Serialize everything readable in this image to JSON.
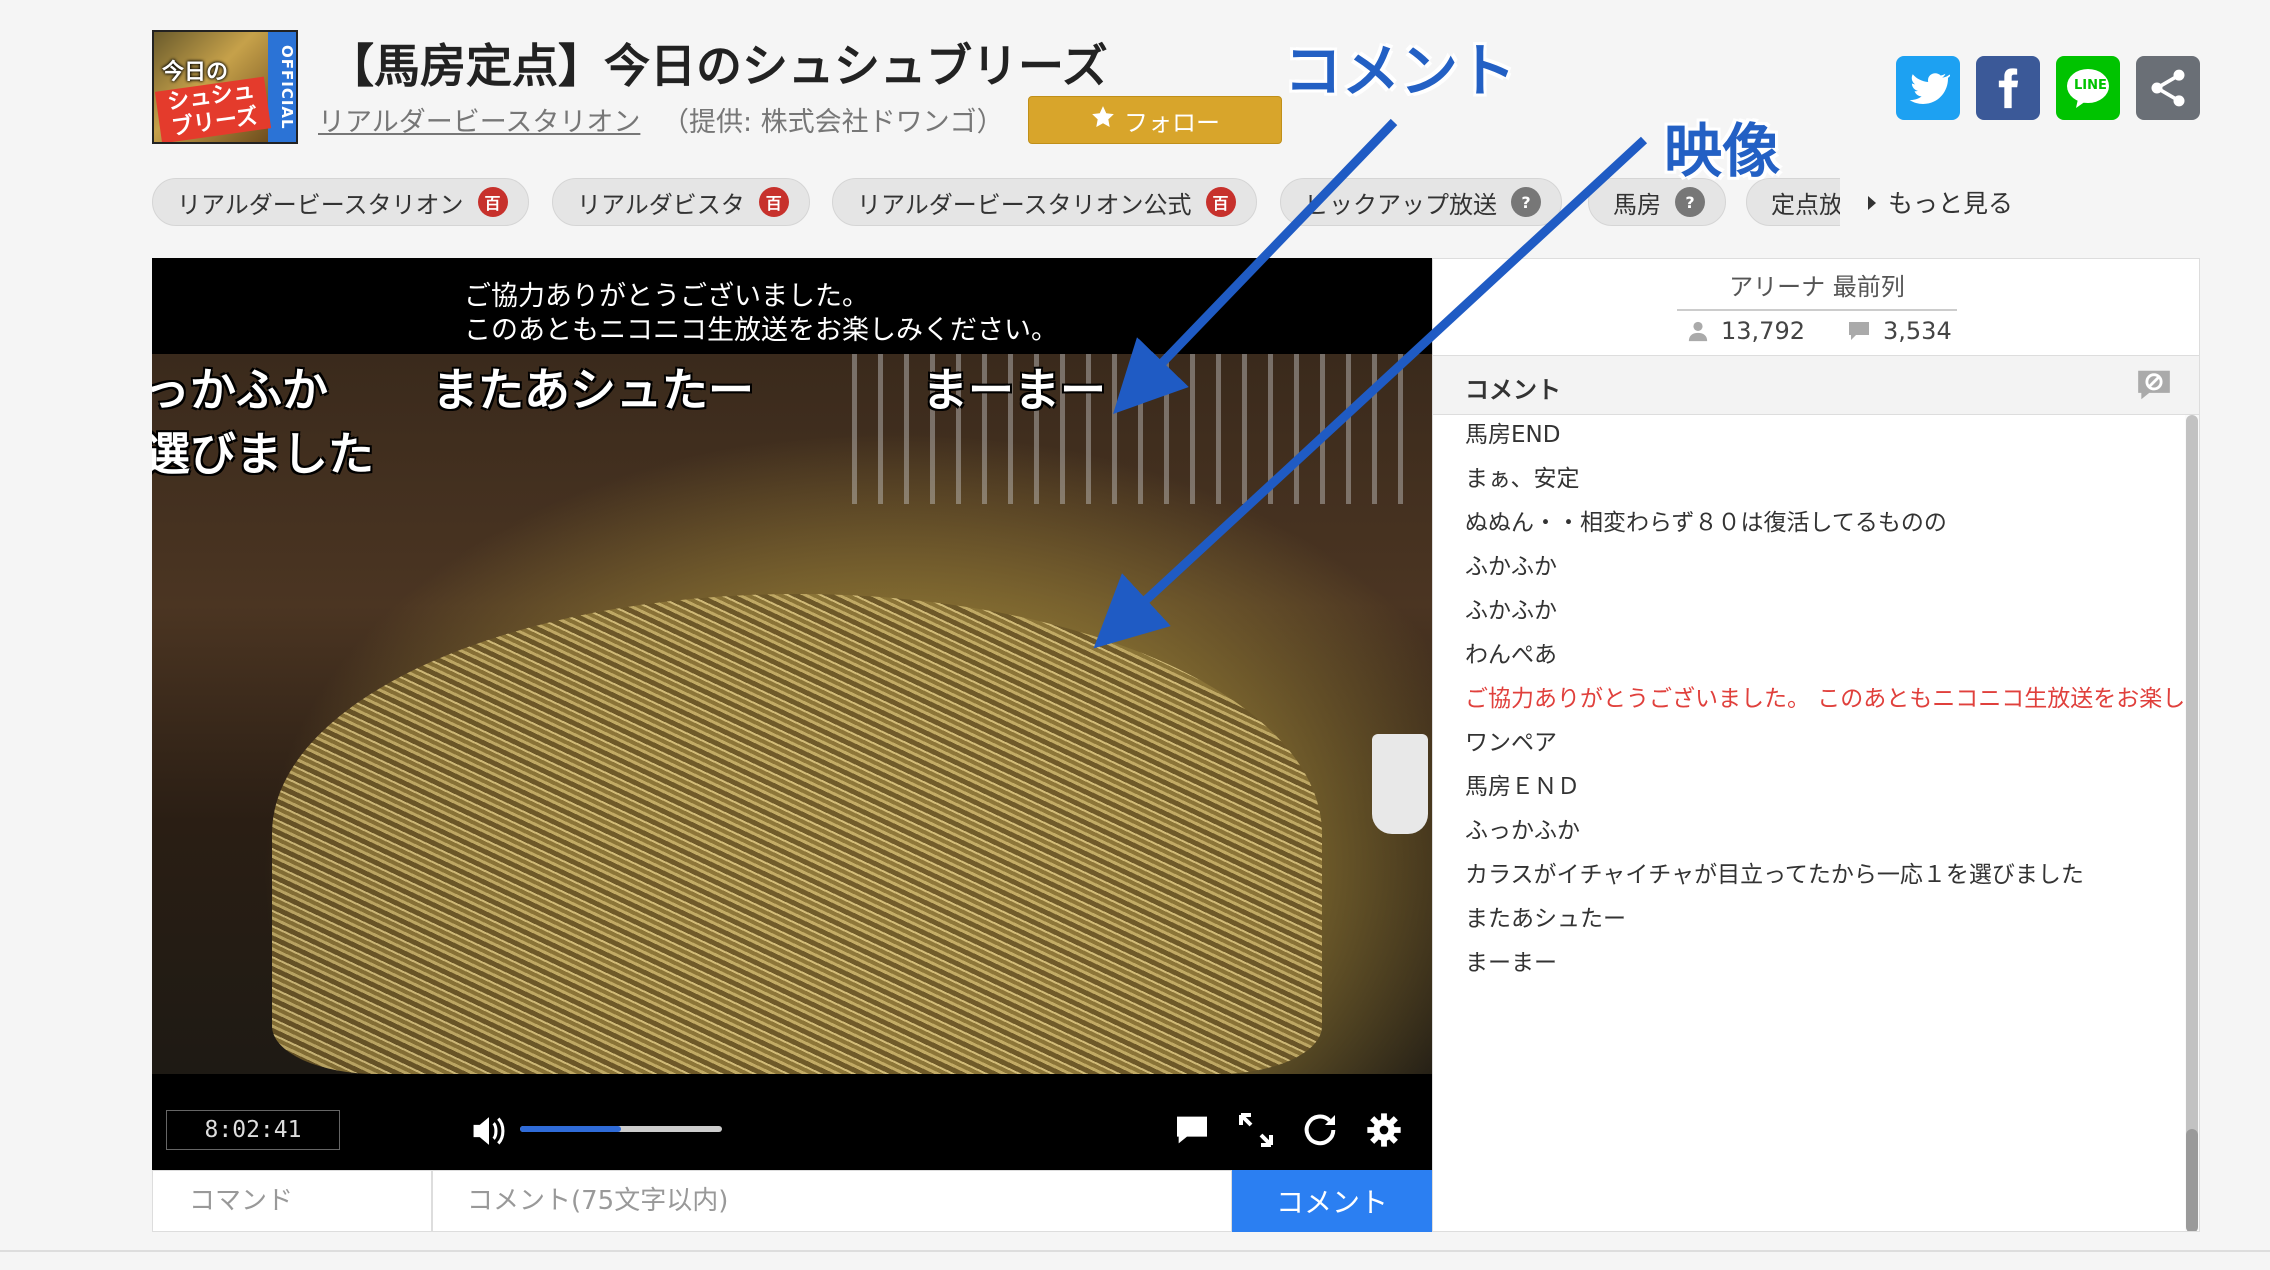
{
  "header": {
    "thumbnail": {
      "official_label": "OFFICIAL",
      "line1": "今日の",
      "line2": "シュシュ",
      "line3": "ブリーズ"
    },
    "title": "【馬房定点】今日のシュシュブリーズ",
    "provider_link": "リアルダービースタリオン",
    "provider_note": "（提供: 株式会社ドワンゴ）",
    "follow_label": "フォロー",
    "share_buttons": [
      "twitter-icon",
      "facebook-icon",
      "line-icon",
      "share-icon"
    ],
    "line_label": "LINE"
  },
  "tags": [
    {
      "label": "リアルダービースタリオン",
      "icon": "百",
      "lock": "locked"
    },
    {
      "label": "リアルダビスタ",
      "icon": "百",
      "lock": "locked"
    },
    {
      "label": "リアルダービースタリオン公式",
      "icon": "百",
      "lock": "locked"
    },
    {
      "label": "ピックアップ放送",
      "icon": "?",
      "lock": "unlocked"
    },
    {
      "label": "馬房",
      "icon": "?",
      "lock": "unlocked"
    },
    {
      "label": "定点放送",
      "icon": "?",
      "lock": "unlocked"
    }
  ],
  "more_tags_label": "もっと見る",
  "player": {
    "notice_line1": "ご協力ありがとうございました。",
    "notice_line2": "このあともニコニコ生放送をお楽しみください。",
    "flowing_comments": [
      "っかふか",
      "選びました",
      "またあシュたー",
      "まーまー"
    ],
    "time": "8:02:41",
    "volume_level": 0.5,
    "command_placeholder": "コマンド",
    "comment_placeholder": "コメント(75文字以内)",
    "submit_label": "コメント"
  },
  "panel": {
    "seat_label": "アリーナ 最前列",
    "viewers": "13,792",
    "comment_count": "3,534",
    "header_label": "コメント",
    "comments": [
      {
        "text": "馬房END",
        "system": false
      },
      {
        "text": "まぁ、安定",
        "system": false
      },
      {
        "text": "ぬぬん・・相変わらず８０は復活してるものの",
        "system": false
      },
      {
        "text": "ふかふか",
        "system": false
      },
      {
        "text": "ふかふか",
        "system": false
      },
      {
        "text": "わんぺあ",
        "system": false
      },
      {
        "text": "ご協力ありがとうございました。 このあともニコニコ生放送をお楽しみください。",
        "system": true
      },
      {
        "text": "ワンペア",
        "system": false
      },
      {
        "text": "馬房ＥＮＤ",
        "system": false
      },
      {
        "text": "ふっかふか",
        "system": false
      },
      {
        "text": "カラスがイチャイチャが目立ってたから一応１を選びました",
        "system": false
      },
      {
        "text": "またあシュたー",
        "system": false
      },
      {
        "text": "まーまー",
        "system": false
      }
    ]
  },
  "annotations": {
    "comment_label": "コメント",
    "video_label": "映像",
    "color": "#1f5bc4"
  },
  "colors": {
    "follow": "#d8a52b",
    "submit": "#2b7ff2",
    "system_comment": "#e0403c"
  }
}
